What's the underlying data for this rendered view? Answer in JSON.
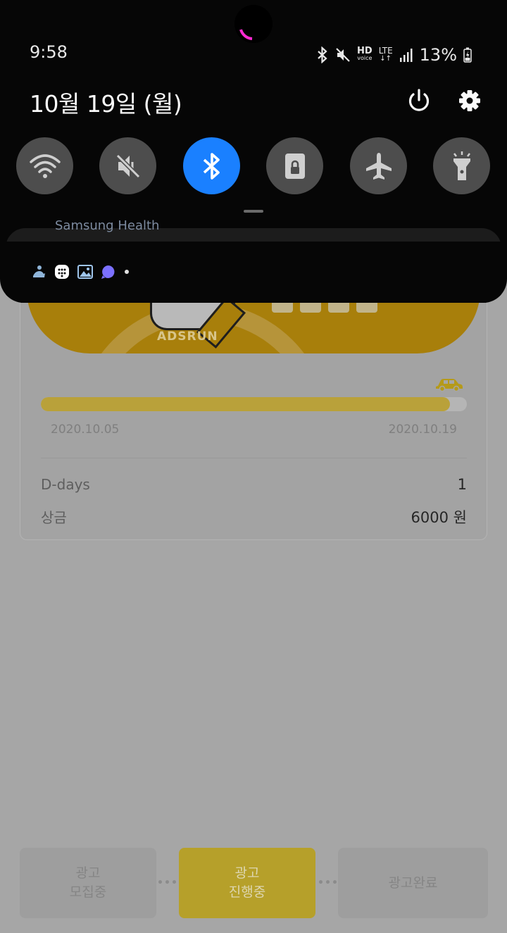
{
  "status_bar": {
    "time": "9:58",
    "battery": "13%",
    "network_label_hd": "HD",
    "network_label_voice": "voice",
    "network_label_lte": "LTE"
  },
  "shade": {
    "date": "10월 19일 (월)",
    "quick_settings": [
      {
        "name": "wifi",
        "icon": "wifi-icon",
        "active": false
      },
      {
        "name": "sound",
        "icon": "mute-icon",
        "active": false
      },
      {
        "name": "bluetooth",
        "icon": "bluetooth-icon",
        "active": true
      },
      {
        "name": "secure-folder",
        "icon": "lock-icon",
        "active": false
      },
      {
        "name": "airplane",
        "icon": "airplane-icon",
        "active": false
      },
      {
        "name": "flashlight",
        "icon": "flashlight-icon",
        "active": false
      }
    ],
    "notification_app": "Samsung Health",
    "accent": "#1a80ff"
  },
  "app": {
    "banner_logo": "ADSRUN",
    "progress": 0.96,
    "date_start": "2020.10.05",
    "date_end": "2020.10.19",
    "rows": [
      {
        "label": "D-days",
        "value": "1"
      },
      {
        "label": "상금",
        "value": "6000 원"
      }
    ],
    "tabs": [
      {
        "label": "광고\n모집중",
        "active": false
      },
      {
        "label": "광고\n진행중",
        "active": true
      },
      {
        "label": "광고완료",
        "active": false
      }
    ]
  }
}
